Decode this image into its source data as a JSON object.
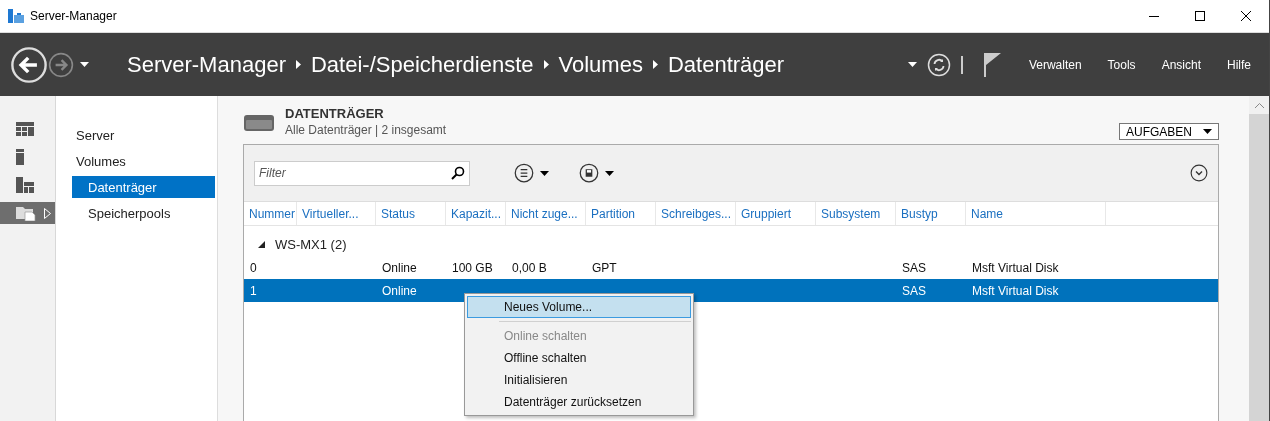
{
  "window": {
    "title": "Server-Manager"
  },
  "header": {
    "breadcrumb": [
      "Server-Manager",
      "Datei-/Speicherdienste",
      "Volumes",
      "Datenträger"
    ],
    "menu": [
      "Verwalten",
      "Tools",
      "Ansicht",
      "Hilfe"
    ]
  },
  "rail": [
    {
      "selected": false
    },
    {
      "selected": false
    },
    {
      "selected": false
    },
    {
      "selected": true
    }
  ],
  "nav": [
    {
      "label": "Server",
      "selected": false
    },
    {
      "label": "Volumes",
      "selected": false,
      "children": [
        {
          "label": "Datenträger",
          "selected": true
        },
        {
          "label": "Speicherpools",
          "selected": false
        }
      ]
    }
  ],
  "section": {
    "title": "DATENTRÄGER",
    "subtitle": "Alle Datenträger | 2 insgesamt",
    "tasks_button": "AUFGABEN"
  },
  "filter": {
    "placeholder": "Filter"
  },
  "table": {
    "columns": [
      "Nummer",
      "Virtueller...",
      "Status",
      "Kapazit...",
      "Nicht zuge...",
      "Partition",
      "Schreibges...",
      "Gruppiert",
      "Subsystem",
      "Bustyp",
      "Name"
    ],
    "groups": [
      {
        "label": "WS-MX1 (2)",
        "expanded": true,
        "rows": [
          {
            "number": "0",
            "status": "Online",
            "capacity": "100 GB",
            "unallocated": "0,00 B",
            "partition": "GPT",
            "bus_type": "SAS",
            "name": "Msft Virtual Disk",
            "selected": false
          },
          {
            "number": "1",
            "status": "Online",
            "bus_type": "SAS",
            "name": "Msft Virtual Disk",
            "selected": true
          }
        ]
      }
    ]
  },
  "context_menu": [
    {
      "kind": "item",
      "label": "Neues Volume...",
      "disabled": false,
      "highlighted": true
    },
    {
      "kind": "separator"
    },
    {
      "kind": "item",
      "label": "Online schalten",
      "disabled": true,
      "highlighted": false
    },
    {
      "kind": "item",
      "label": "Offline schalten",
      "disabled": false,
      "highlighted": false
    },
    {
      "kind": "item",
      "label": "Initialisieren",
      "disabled": false,
      "highlighted": false
    },
    {
      "kind": "item",
      "label": "Datenträger zurücksetzen",
      "disabled": false,
      "highlighted": false
    }
  ]
}
